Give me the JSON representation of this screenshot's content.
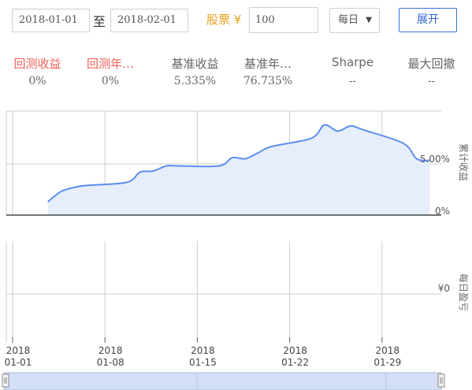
{
  "toolbar": {
    "start_date": "2018-01-01",
    "to_label": "至",
    "end_date": "2018-02-01",
    "stock_label": "股票 ¥",
    "capital": "100",
    "frequency": "每日",
    "frequency_caret": "▼",
    "expand_label": "展开"
  },
  "stats": [
    {
      "label": "回测收益",
      "value": "0%"
    },
    {
      "label": "回测年…",
      "value": "0%"
    },
    {
      "label": "基准收益",
      "value": "5.335%"
    },
    {
      "label": "基准年…",
      "value": "76.735%"
    },
    {
      "label": "Sharpe",
      "value": "--"
    },
    {
      "label": "最大回撤",
      "value": "--"
    }
  ],
  "colors": {
    "accent": "#2f63cf",
    "negative_label": "#f0605a",
    "stock_label": "#e8a020",
    "line": "#5b8ff0",
    "area": "#e6eefc"
  },
  "chart_data": [
    {
      "type": "area",
      "ylabel": "累计收益",
      "ytick_labels": [
        "5.00%",
        "0%"
      ],
      "x": [
        "2018-01-02",
        "2018-01-03",
        "2018-01-04",
        "2018-01-05",
        "2018-01-08",
        "2018-01-09",
        "2018-01-10",
        "2018-01-11",
        "2018-01-12",
        "2018-01-15",
        "2018-01-16",
        "2018-01-17",
        "2018-01-18",
        "2018-01-19",
        "2018-01-22",
        "2018-01-23",
        "2018-01-24",
        "2018-01-25",
        "2018-01-26",
        "2018-01-29",
        "2018-01-30",
        "2018-01-31"
      ],
      "series": [
        {
          "values": [
            1.3,
            2.3,
            2.7,
            2.9,
            3.2,
            4.2,
            4.3,
            4.8,
            4.8,
            4.8,
            5.6,
            5.5,
            6.1,
            6.7,
            7.5,
            8.8,
            8.2,
            8.7,
            8.3,
            7.0,
            5.5,
            5.335
          ]
        }
      ],
      "x_ticks": [
        {
          "year": "2018",
          "day": "01-01"
        },
        {
          "year": "2018",
          "day": "01-08"
        },
        {
          "year": "2018",
          "day": "01-15"
        },
        {
          "year": "2018",
          "day": "01-22"
        },
        {
          "year": "2018",
          "day": "01-29"
        }
      ]
    },
    {
      "type": "bar",
      "ylabel": "每日盈亏",
      "ytick_labels": [
        "¥0"
      ],
      "series": [
        {
          "values": []
        }
      ]
    }
  ]
}
